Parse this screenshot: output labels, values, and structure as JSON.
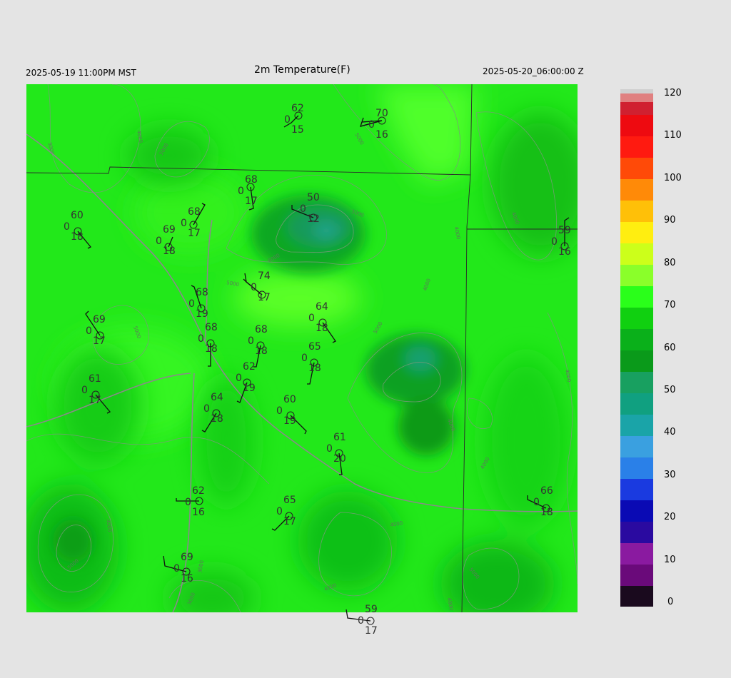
{
  "header": {
    "local_time": "2025-05-19 11:00PM MST",
    "title": "2m Temperature(F)",
    "valid_time": "2025-05-20_06:00:00 Z"
  },
  "colorbar": {
    "ticks": [
      "0",
      "10",
      "20",
      "30",
      "40",
      "50",
      "60",
      "70",
      "80",
      "90",
      "100",
      "110",
      "120"
    ],
    "stops": [
      {
        "v": 0,
        "color": "#1a0a1e"
      },
      {
        "v": 5,
        "color": "#6a0a7a"
      },
      {
        "v": 10,
        "color": "#8a1aa0"
      },
      {
        "v": 15,
        "color": "#2a0aa0"
      },
      {
        "v": 20,
        "color": "#0a0ab4"
      },
      {
        "v": 25,
        "color": "#1a3ae0"
      },
      {
        "v": 30,
        "color": "#2a80e8"
      },
      {
        "v": 35,
        "color": "#3aa0e0"
      },
      {
        "v": 40,
        "color": "#1aa4a8"
      },
      {
        "v": 45,
        "color": "#10a080"
      },
      {
        "v": 50,
        "color": "#18a060"
      },
      {
        "v": 55,
        "color": "#0a9a1a"
      },
      {
        "v": 60,
        "color": "#0ab01a"
      },
      {
        "v": 65,
        "color": "#10d010"
      },
      {
        "v": 70,
        "color": "#2aff1a"
      },
      {
        "v": 75,
        "color": "#8aff2a"
      },
      {
        "v": 80,
        "color": "#ccff1a"
      },
      {
        "v": 85,
        "color": "#ffee10"
      },
      {
        "v": 90,
        "color": "#ffc008"
      },
      {
        "v": 95,
        "color": "#ff8a08"
      },
      {
        "v": 100,
        "color": "#ff4a08"
      },
      {
        "v": 105,
        "color": "#ff1a10"
      },
      {
        "v": 110,
        "color": "#ee0a10"
      },
      {
        "v": 115,
        "color": "#d02030"
      },
      {
        "v": 118,
        "color": "#e08080"
      },
      {
        "v": 120,
        "color": "#d0d0d0"
      }
    ]
  },
  "contour_labels": [
    "3000",
    "4000",
    "5000",
    "6000",
    "7000"
  ],
  "stations": [
    {
      "t": "62",
      "d": "0",
      "v": "15"
    },
    {
      "t": "70",
      "d": "0",
      "v": "16"
    },
    {
      "t": "68",
      "d": "0",
      "v": "17"
    },
    {
      "t": "50",
      "d": "0",
      "v": "12"
    },
    {
      "t": "68",
      "d": "0",
      "v": "17"
    },
    {
      "t": "69",
      "d": "0",
      "v": "18"
    },
    {
      "t": "60",
      "d": "0",
      "v": "18"
    },
    {
      "t": "59",
      "d": "0",
      "v": "16"
    },
    {
      "t": "74",
      "d": "0",
      "v": "17"
    },
    {
      "t": "68",
      "d": "0",
      "v": "19"
    },
    {
      "t": "64",
      "d": "0",
      "v": "18"
    },
    {
      "t": "69",
      "d": "0",
      "v": "17"
    },
    {
      "t": "68",
      "d": "0",
      "v": "18"
    },
    {
      "t": "68",
      "d": "0",
      "v": "18"
    },
    {
      "t": "65",
      "d": "0",
      "v": "18"
    },
    {
      "t": "62",
      "d": "0",
      "v": "19"
    },
    {
      "t": "61",
      "d": "0",
      "v": "17"
    },
    {
      "t": "64",
      "d": "0",
      "v": "18"
    },
    {
      "t": "60",
      "d": "0",
      "v": "19"
    },
    {
      "t": "61",
      "d": "0",
      "v": "20"
    },
    {
      "t": "62",
      "d": "0",
      "v": "16"
    },
    {
      "t": "65",
      "d": "0",
      "v": "17"
    },
    {
      "t": "66",
      "d": "0",
      "v": "18"
    },
    {
      "t": "69",
      "d": "0",
      "v": "16"
    },
    {
      "t": "59",
      "d": "0",
      "v": "17"
    }
  ]
}
